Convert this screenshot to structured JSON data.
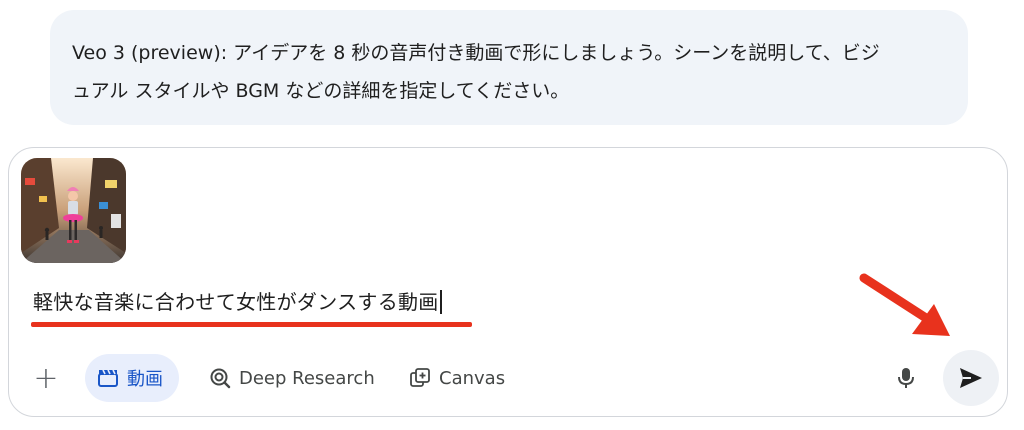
{
  "info": {
    "line1": "Veo 3 (preview): アイデアを 8 秒の音声付き動画で形にしましょう。シーンを説明して、ビジ",
    "line2": "ュアル スタイルや BGM などの詳細を指定してください。"
  },
  "prompt": {
    "text": "軽快な音楽に合わせて女性がダンスする動画"
  },
  "toolbar": {
    "add_label": "+",
    "video_label": "動画",
    "deep_research_label": "Deep Research",
    "canvas_label": "Canvas"
  },
  "colors": {
    "accent": "#1a56c7",
    "annotation": "#e8321d",
    "bubble_bg": "#f0f4f9"
  },
  "icons": {
    "video": "clapperboard-icon",
    "deep_research": "deep-research-icon",
    "canvas": "canvas-icon",
    "mic": "mic-icon",
    "send": "send-icon"
  }
}
